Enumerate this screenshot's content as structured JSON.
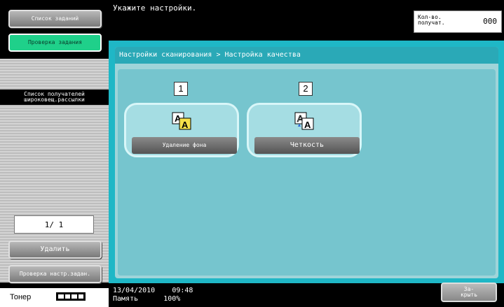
{
  "header": {
    "message": "Укажите настройки.",
    "count_label": "Кол-во. получат.",
    "count_value": "000"
  },
  "left_panel": {
    "job_list_button": "Список заданий",
    "job_check_button": "Проверка задания",
    "recipient_list_title": "Список получателей широковещ.рассылки",
    "page_counter": "1/ 1",
    "delete_button": "Удалить",
    "check_settings_button": "Проверка настр.задан.",
    "toner_label": "Тонер"
  },
  "breadcrumb": "Настройки сканирования > Настройка качества",
  "options": [
    {
      "number": "1",
      "label": "Удаление фона",
      "icon": "background-removal-icon"
    },
    {
      "number": "2",
      "label": "Четкость",
      "icon": "sharpness-icon"
    }
  ],
  "footer": {
    "date": "13/04/2010",
    "time": "09:48",
    "memory_label": "Память",
    "memory_value": "100%",
    "close_button": "За-\nкрыть"
  },
  "colors": {
    "accent_cyan": "#1fb7c6",
    "active_green": "#1fd08a"
  }
}
